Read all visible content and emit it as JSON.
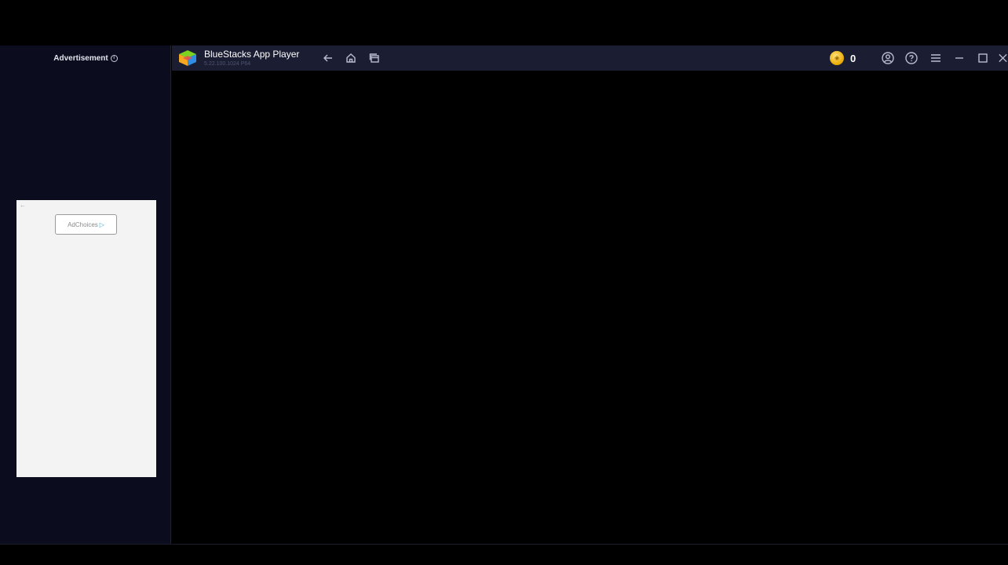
{
  "ad_panel": {
    "header_label": "Advertisement",
    "info_symbol": "i",
    "back_arrow_symbol": "←",
    "adchoices_label": "AdChoices",
    "adchoices_symbol": "▷"
  },
  "window": {
    "app_title": "BlueStacks App Player",
    "app_version": "5.22.100.1024 P64",
    "logo_icon": "bluestacks-logo-icon",
    "nav_icons": [
      "back-arrow-icon",
      "home-icon",
      "multi-instance-icon"
    ],
    "coin_symbol": "◉",
    "coin_count": "0",
    "right_icons": [
      "account-icon",
      "help-icon",
      "menu-icon",
      "minimize-icon",
      "maximize-icon",
      "close-icon"
    ]
  },
  "colors": {
    "background": "#000000",
    "panel": "#0b0d1e",
    "topbar": "#1b1d33",
    "coin": "#e9a900",
    "adchoices_accent": "#2bb0d6"
  }
}
